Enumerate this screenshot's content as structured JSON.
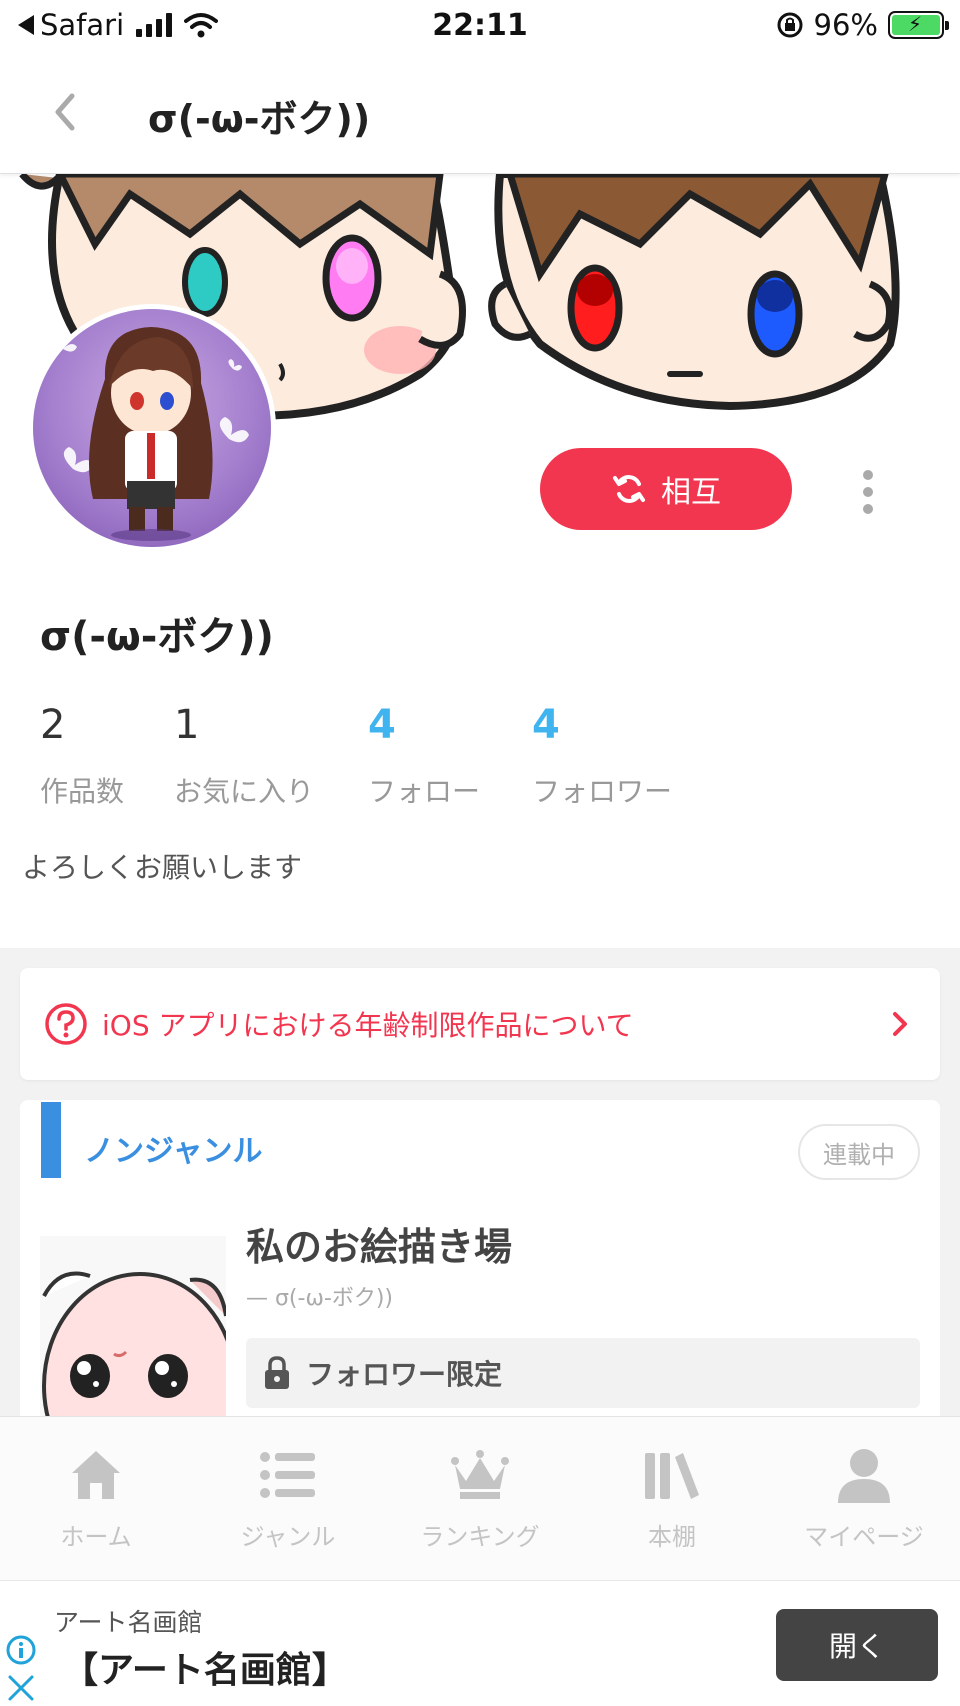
{
  "status_bar": {
    "back_app": "Safari",
    "time": "22:11",
    "battery": "96%"
  },
  "header": {
    "title": "σ(-ω-ボク))"
  },
  "profile": {
    "follow_button": "相互",
    "name": "σ(-ω-ボク))",
    "bio": "よろしくお願いします",
    "stats": [
      {
        "value": "2",
        "label": "作品数"
      },
      {
        "value": "1",
        "label": "お気に入り"
      },
      {
        "value": "4",
        "label": "フォロー"
      },
      {
        "value": "4",
        "label": "フォロワー"
      }
    ]
  },
  "notice": {
    "text": "iOS アプリにおける年齢制限作品について"
  },
  "series": {
    "genre": "ノンジャンル",
    "status": "連載中",
    "title": "私のお絵描き場",
    "author": "— σ(-ω-ボク))",
    "restriction": "フォロワー限定"
  },
  "tabs": [
    {
      "label": "ホーム",
      "icon": "home-icon"
    },
    {
      "label": "ジャンル",
      "icon": "list-icon"
    },
    {
      "label": "ランキング",
      "icon": "crown-icon"
    },
    {
      "label": "本棚",
      "icon": "bookshelf-icon"
    },
    {
      "label": "マイページ",
      "icon": "person-icon"
    }
  ],
  "ad": {
    "sponsor": "アート名画館",
    "headline": "【アート名画館】",
    "button": "開く"
  },
  "colors": {
    "accent_red": "#f2364f",
    "accent_blue": "#3fb4ee",
    "genre_blue": "#3a8fe0"
  }
}
